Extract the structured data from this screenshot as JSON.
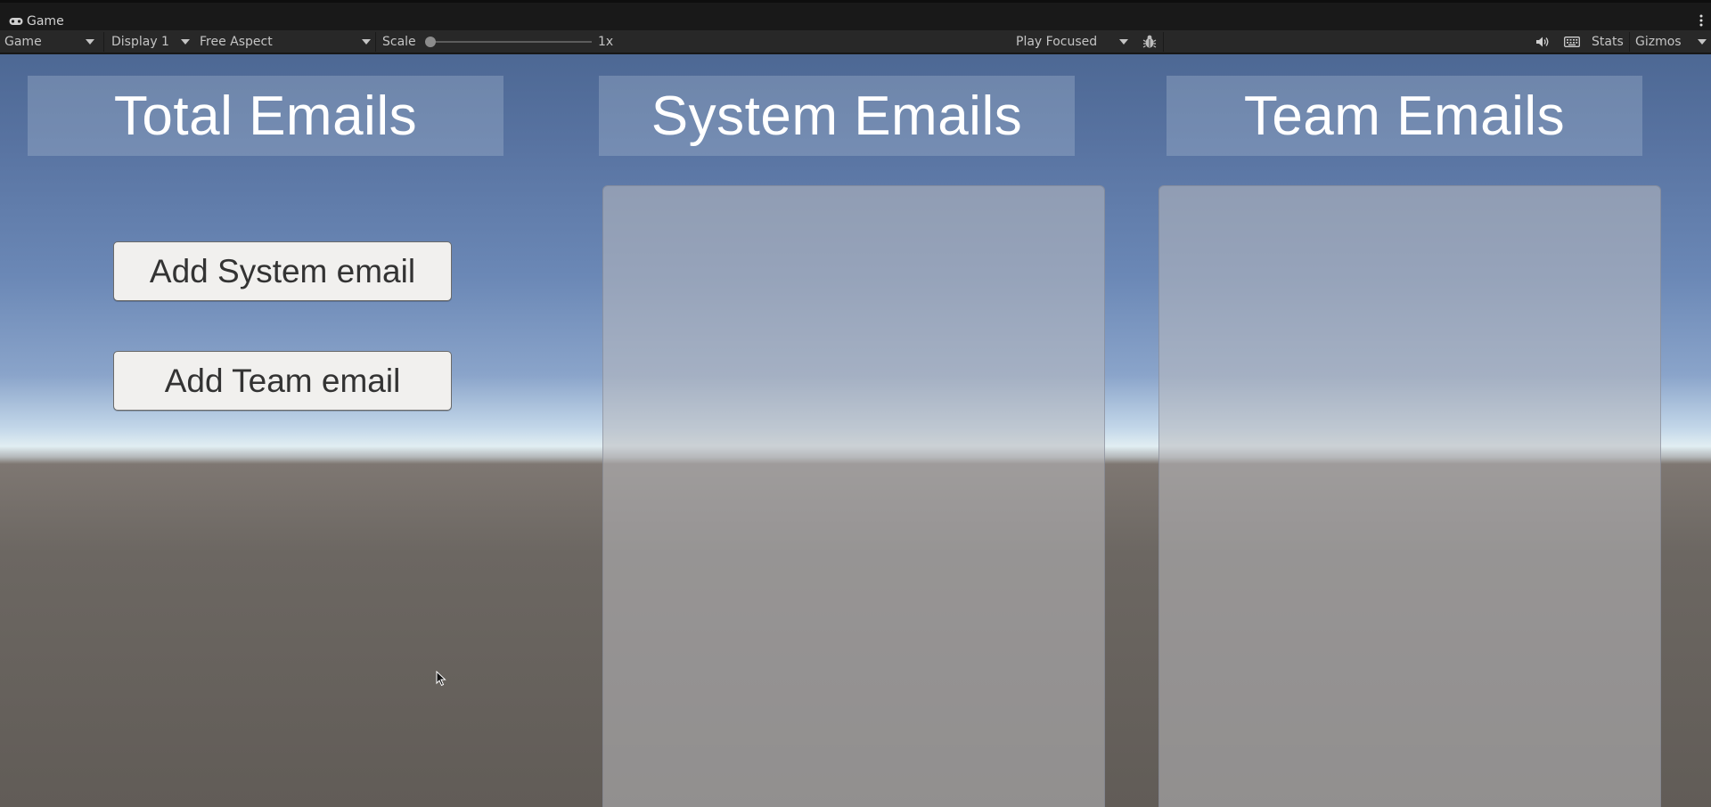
{
  "window": {
    "tab_label": "Game",
    "tab_icon": "gamepad-icon",
    "menu_icon": "kebab-menu-icon"
  },
  "toolbar": {
    "view_dropdown": "Game",
    "display_dropdown": "Display 1",
    "aspect_dropdown": "Free Aspect",
    "scale_label": "Scale",
    "scale_value": "1x",
    "scale_level": 0,
    "play_mode_dropdown": "Play Focused",
    "bug_icon": "bug-icon",
    "mute_icon": "speaker-icon",
    "keyboard_icon": "keyboard-icon",
    "stats_label": "Stats",
    "gizmos_label": "Gizmos"
  },
  "game": {
    "headers": {
      "total": "Total Emails",
      "system": "System Emails",
      "team": "Team Emails"
    },
    "buttons": {
      "add_system": "Add System email",
      "add_team": "Add Team email"
    }
  },
  "colors": {
    "editor_bg": "#191919",
    "toolbar_bg": "#282828",
    "sky_top": "#4d6894",
    "horizon": "#e1eef2",
    "ground": "#615c57"
  }
}
